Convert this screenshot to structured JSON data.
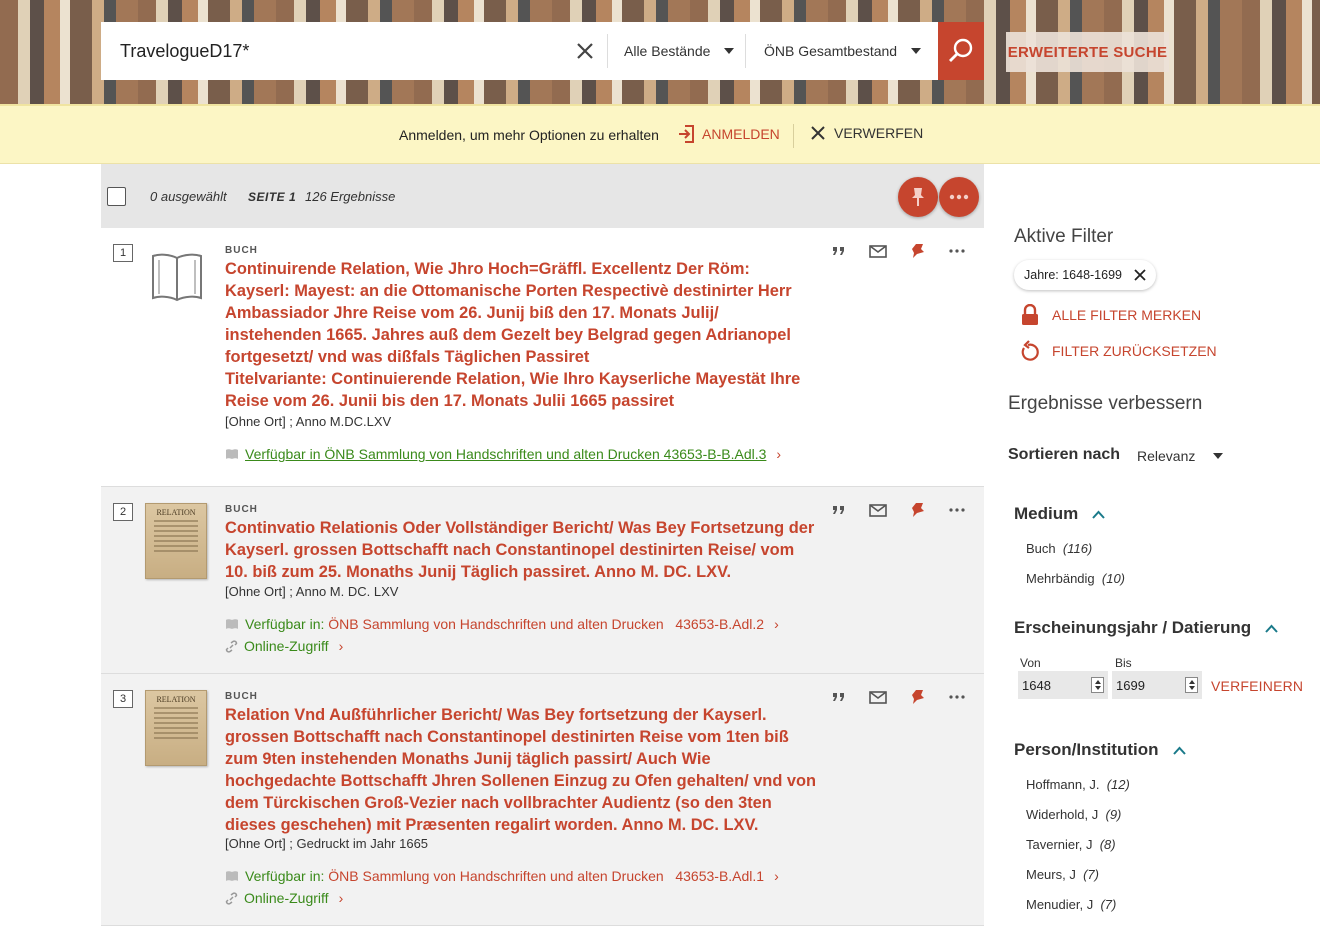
{
  "search": {
    "query": "TravelogueD17*",
    "scope1": "Alle Bestände",
    "scope2": "ÖNB Gesamtbestand",
    "advanced_label": "ERWEITERTE SUCHE"
  },
  "login_bar": {
    "message": "Anmelden, um mehr Optionen zu erhalten",
    "login_label": "ANMELDEN",
    "dismiss_label": "VERWERFEN"
  },
  "toolbar": {
    "selected": "0 ausgewählt",
    "page": "SEITE 1",
    "count": "126 Ergebnisse"
  },
  "results": [
    {
      "num": "1",
      "type": "BUCH",
      "title": "Continuirende Relation, Wie Jhro Hoch=Gräffl. Excellentz Der Röm: Kayserl: Mayest: an die Ottomanische Porten Respectivè destinirter Herr Ambassiador Jhre Reise vom 26. Junij biß den 17. Monats Julij/ instehenden 1665. Jahres auß dem Gezelt bey Belgrad gegen Adrianopel fortgesetzt/ vnd was dißfals Täglichen Passiret",
      "variant": "Titelvariante: Continuierende Relation, Wie Ihro Kayserliche Mayestät Ihre Reise vom 26. Junii bis den 17. Monats Julii 1665 passiret",
      "meta": "[Ohne Ort] ; Anno M.DC.LXV",
      "avail": "Verfügbar in ÖNB Sammlung von Handschriften und alten Drucken   43653-B-B.Adl.3"
    },
    {
      "num": "2",
      "type": "BUCH",
      "title": "Continvatio Relationis Oder Vollständiger Bericht/ Was Bey Fortsetzung der Kayserl. grossen Bottschafft nach Constantinopel destinirten Reise/ vom 10. biß zum 25. Monaths Junij Täglich passiret. Anno M. DC. LXV.",
      "meta": "[Ohne Ort] ; Anno M. DC. LXV",
      "avail_prefix": "Verfügbar in:",
      "avail_loc": "ÖNB Sammlung von Handschriften und alten Drucken",
      "avail_sig": "43653-B.Adl.2",
      "online": "Online-Zugriff",
      "thumb_text": "RELATION"
    },
    {
      "num": "3",
      "type": "BUCH",
      "title": "Relation Vnd Außführlicher Bericht/ Was Bey fortsetzung der Kayserl. grossen Bottschafft nach Constantinopel destinirten Reise vom 1ten biß zum 9ten instehenden Monaths Junij täglich passirt/ Auch Wie hochgedachte Bottschafft Jhren Sollenen Einzug zu Ofen gehalten/ vnd von dem Türckischen Groß-Vezier nach vollbrachter Audientz (so den 3ten dieses geschehen) mit Præsenten regalirt worden. Anno M. DC. LXV.",
      "meta": "[Ohne Ort] ; Gedruckt im Jahr 1665",
      "avail_prefix": "Verfügbar in:",
      "avail_loc": "ÖNB Sammlung von Handschriften und alten Drucken",
      "avail_sig": "43653-B.Adl.1",
      "online": "Online-Zugriff",
      "thumb_text": "RELATION"
    }
  ],
  "sidebar": {
    "active_filters_title": "Aktive Filter",
    "chip": "Jahre: 1648-1699",
    "keep_filters": "ALLE FILTER MERKEN",
    "reset_filters": "FILTER ZURÜCKSETZEN",
    "improve_title": "Ergebnisse verbessern",
    "sort_label": "Sortieren nach",
    "sort_value": "Relevanz",
    "medium_title": "Medium",
    "medium_items": [
      {
        "label": "Buch",
        "count": "(116)"
      },
      {
        "label": "Mehrbändig",
        "count": "(10)"
      }
    ],
    "year_title": "Erscheinungsjahr / Datierung",
    "from_label": "Von",
    "to_label": "Bis",
    "from_value": "1648",
    "to_value": "1699",
    "refine_label": "VERFEINERN",
    "person_title": "Person/Institution",
    "person_items": [
      {
        "label": "Hoffmann, J.",
        "count": "(12)"
      },
      {
        "label": "Widerhold, J",
        "count": "(9)"
      },
      {
        "label": "Tavernier, J",
        "count": "(8)"
      },
      {
        "label": "Meurs, J",
        "count": "(7)"
      },
      {
        "label": "Menudier, J",
        "count": "(7)"
      }
    ]
  },
  "colors": {
    "accent": "#c6452e",
    "available": "#3a8a1a",
    "login_bar": "#fcf6c5"
  },
  "icons": [
    "close-icon",
    "search-icon",
    "login-icon",
    "pin-icon",
    "more-icon",
    "quote-icon",
    "mail-icon",
    "book-icon",
    "link-icon",
    "lock-icon",
    "reset-icon",
    "chevron-up-icon"
  ]
}
